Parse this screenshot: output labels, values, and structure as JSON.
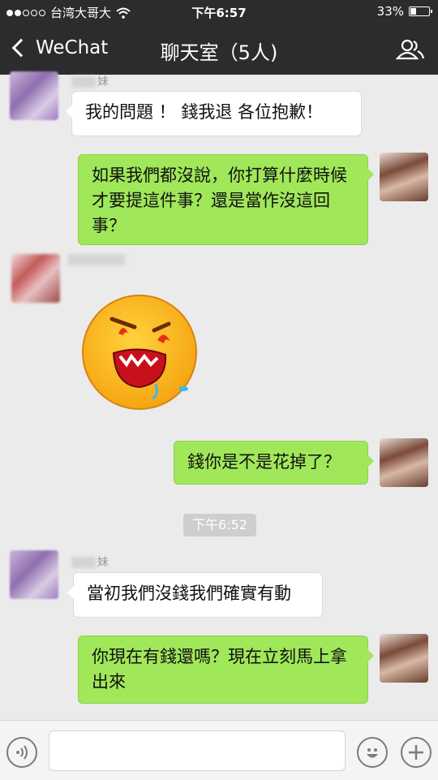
{
  "status_bar": {
    "carrier": "台湾大哥大",
    "time": "下午6:57",
    "battery_percent": "33%",
    "battery_level": 0.33
  },
  "nav": {
    "back_label": "WeChat",
    "title": "聊天室（5人)"
  },
  "messages": [
    {
      "side": "left",
      "sender_suffix": "妹",
      "text": "我的問題 ！ 錢我退 各位抱歉！"
    },
    {
      "side": "right",
      "text": "如果我們都沒說，你打算什麼時候才要提這件事？還是當作沒這回事？"
    },
    {
      "side": "left",
      "sender_suffix": "",
      "type": "sticker",
      "sticker": "angry-emoji-sticker"
    },
    {
      "side": "right",
      "text": "錢你是不是花掉了？"
    },
    {
      "side": "left",
      "sender_suffix": "妹",
      "text": "當初我們沒錢我們確實有動"
    },
    {
      "side": "right",
      "text": "你現在有錢還嗎？現在立刻馬上拿出來"
    }
  ],
  "timestamp": "下午6:52",
  "input_bar": {
    "voice_icon": "voice-icon",
    "emoji_icon": "emoji-icon",
    "plus_icon": "plus-icon",
    "placeholder": ""
  },
  "colors": {
    "header": "#2c2c2e",
    "chat_bg": "#ebebeb",
    "bubble_self": "#a0e75a",
    "bubble_other": "#ffffff"
  }
}
